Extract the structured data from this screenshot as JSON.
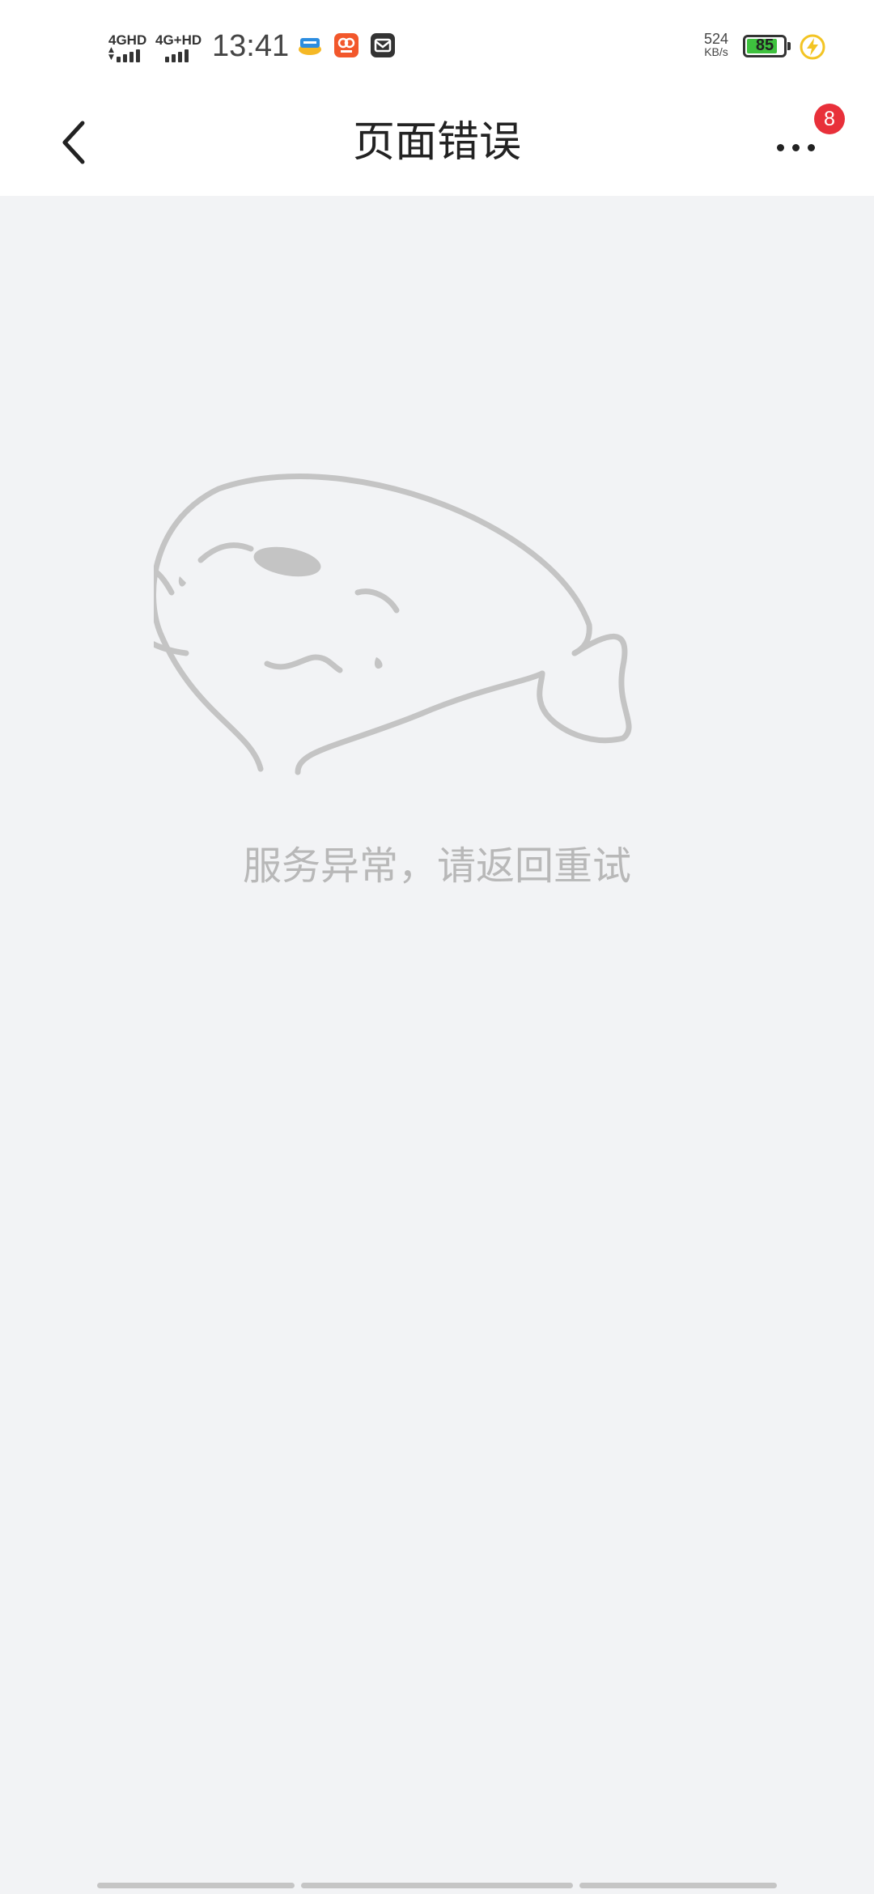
{
  "status_bar": {
    "sim1": "4GHD",
    "sim2": "4G+HD",
    "time": "13:41",
    "net_speed_value": "524",
    "net_speed_unit": "KB/s",
    "battery_level": "85",
    "battery_fraction": 0.85,
    "notification_icons": [
      "news-app-icon",
      "photo-app-icon",
      "mail-icon"
    ],
    "charging_icon": "lightning-icon"
  },
  "nav": {
    "back_icon": "chevron-left-icon",
    "title": "页面错误",
    "more_icon": "more-dots-icon",
    "badge_count": "8"
  },
  "content": {
    "illustration": "sleeping-fish-icon",
    "message": "服务异常，请返回重试"
  },
  "colors": {
    "background": "#f2f3f5",
    "badge": "#e8303a",
    "battery_fill": "#3ec13e",
    "message_text": "#b8b8b8"
  }
}
